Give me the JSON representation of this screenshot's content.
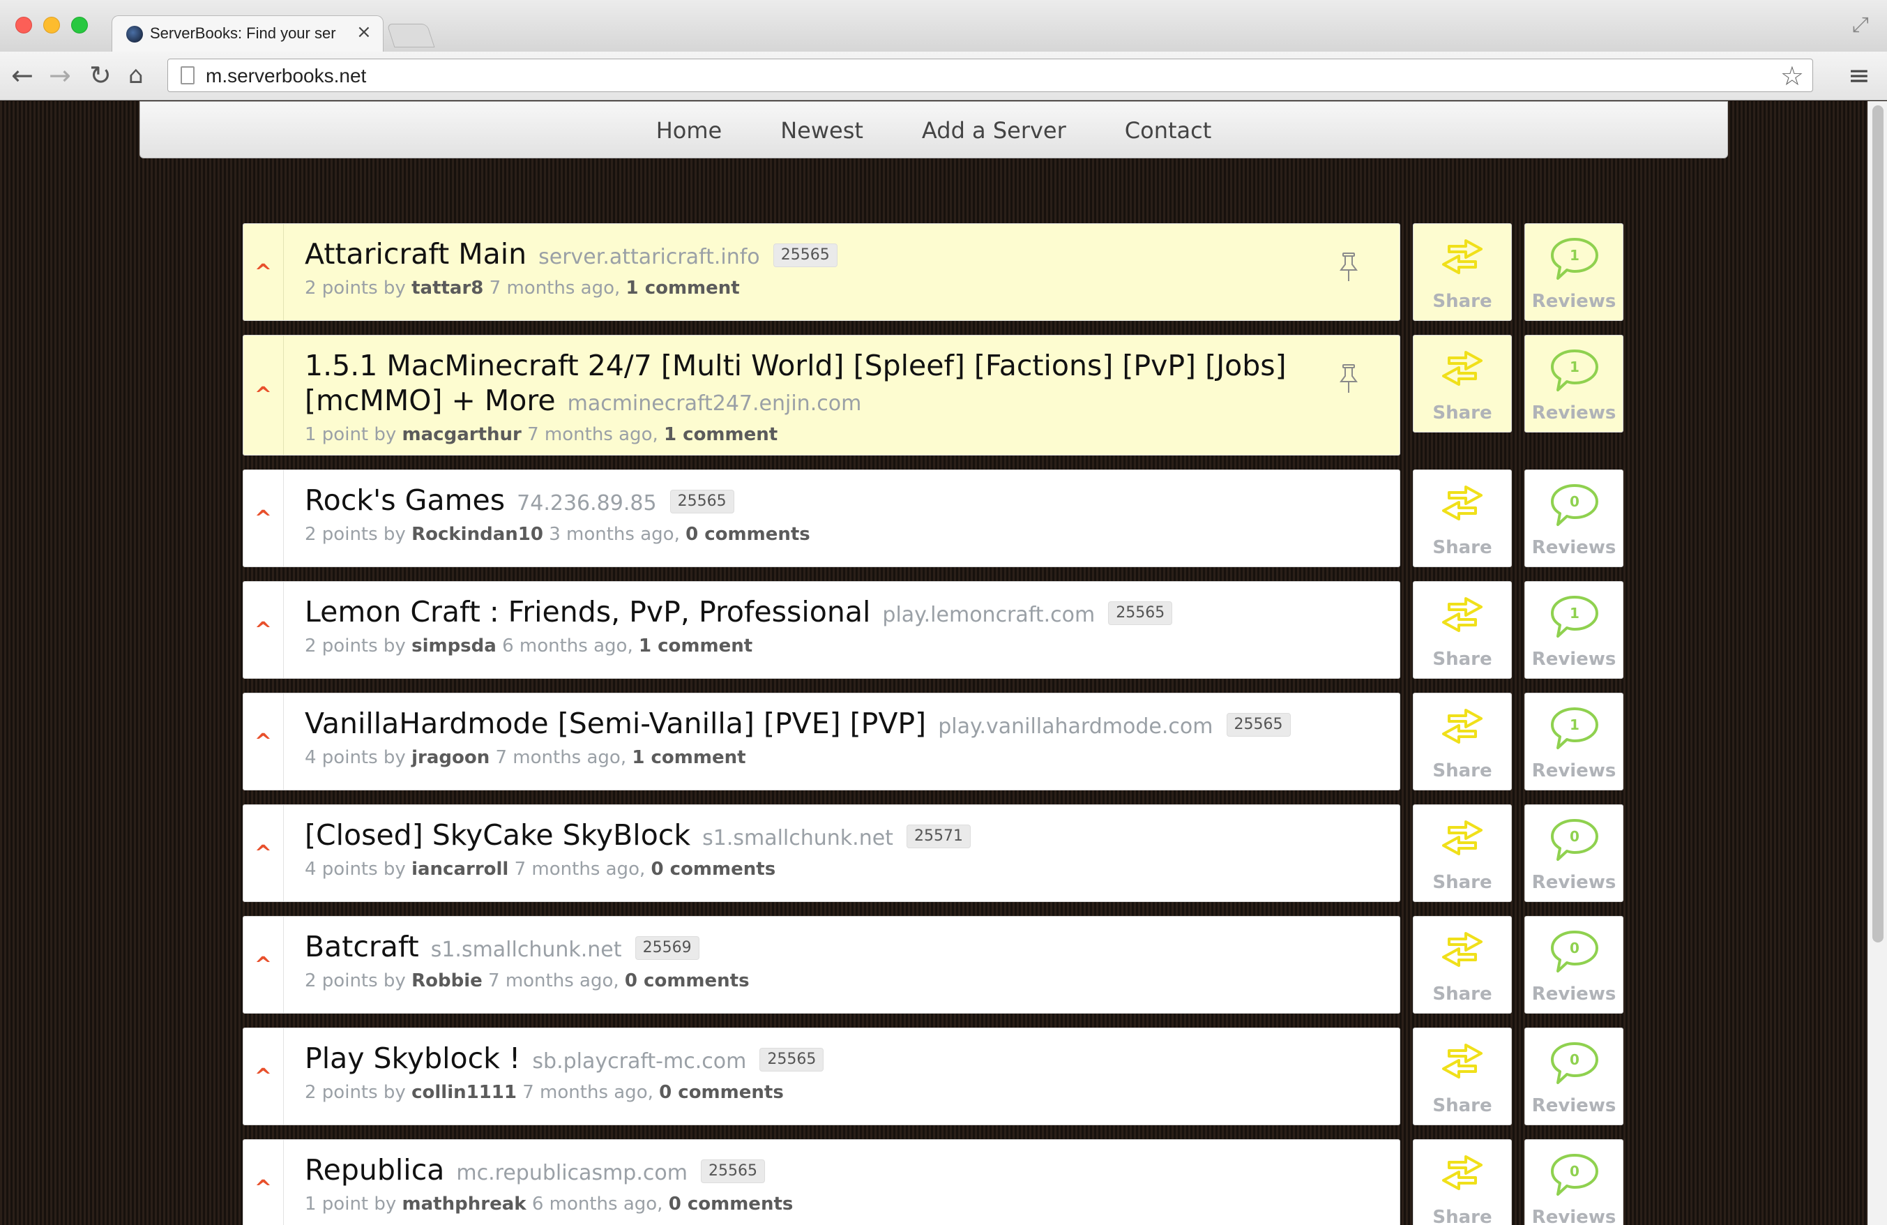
{
  "browser": {
    "tab_title": "ServerBooks: Find your ser",
    "url": "m.serverbooks.net"
  },
  "nav": {
    "items": [
      {
        "label": "Home"
      },
      {
        "label": "Newest"
      },
      {
        "label": "Add a Server"
      },
      {
        "label": "Contact"
      }
    ]
  },
  "actions": {
    "share_label": "Share",
    "reviews_label": "Reviews"
  },
  "colors": {
    "sponsored_bg": "#fdfcd0",
    "upvote": "#e8502c",
    "share_icon": "#f0e01a",
    "reviews_icon": "#8fd14f"
  },
  "servers": [
    {
      "title": "Attaricraft Main",
      "domain": "server.attaricraft.info",
      "port": "25565",
      "points": "2 points by",
      "user": "tattar8",
      "age": "7 months ago,",
      "comments": "1 comment",
      "reviews": "1",
      "sponsored": true
    },
    {
      "title": "1.5.1 MacMinecraft 24/7 [Multi World] [Spleef] [Factions] [PvP] [Jobs] [mcMMO] + More",
      "domain": "macminecraft247.enjin.com",
      "port": "",
      "points": "1 point by",
      "user": "macgarthur",
      "age": "7 months ago,",
      "comments": "1 comment",
      "reviews": "1",
      "sponsored": true
    },
    {
      "title": "Rock's Games",
      "domain": "74.236.89.85",
      "port": "25565",
      "points": "2 points by",
      "user": "Rockindan10",
      "age": "3 months ago,",
      "comments": "0 comments",
      "reviews": "0",
      "sponsored": false
    },
    {
      "title": "Lemon Craft : Friends, PvP, Professional",
      "domain": "play.lemoncraft.com",
      "port": "25565",
      "points": "2 points by",
      "user": "simpsda",
      "age": "6 months ago,",
      "comments": "1 comment",
      "reviews": "1",
      "sponsored": false
    },
    {
      "title": "VanillaHardmode [Semi-Vanilla] [PVE] [PVP]",
      "domain": "play.vanillahardmode.com",
      "port": "25565",
      "points": "4 points by",
      "user": "jragoon",
      "age": "7 months ago,",
      "comments": "1 comment",
      "reviews": "1",
      "sponsored": false
    },
    {
      "title": "[Closed] SkyCake SkyBlock",
      "domain": "s1.smallchunk.net",
      "port": "25571",
      "points": "4 points by",
      "user": "iancarroll",
      "age": "7 months ago,",
      "comments": "0 comments",
      "reviews": "0",
      "sponsored": false
    },
    {
      "title": "Batcraft",
      "domain": "s1.smallchunk.net",
      "port": "25569",
      "points": "2 points by",
      "user": "Robbie",
      "age": "7 months ago,",
      "comments": "0 comments",
      "reviews": "0",
      "sponsored": false
    },
    {
      "title": "Play Skyblock !",
      "domain": "sb.playcraft-mc.com",
      "port": "25565",
      "points": "2 points by",
      "user": "collin1111",
      "age": "7 months ago,",
      "comments": "0 comments",
      "reviews": "0",
      "sponsored": false
    },
    {
      "title": "Republica",
      "domain": "mc.republicasmp.com",
      "port": "25565",
      "points": "1 point by",
      "user": "mathphreak",
      "age": "6 months ago,",
      "comments": "0 comments",
      "reviews": "0",
      "sponsored": false
    }
  ]
}
